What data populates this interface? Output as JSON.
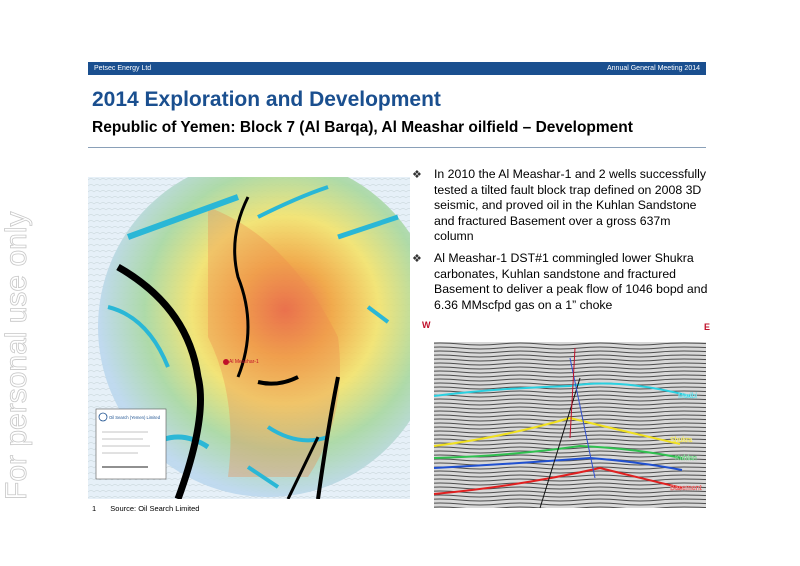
{
  "watermark": "For personal use only",
  "header": {
    "company": "Petsec Energy Ltd",
    "event": "Annual General Meeting 2014"
  },
  "title": "2014 Exploration and Development",
  "subtitle": "Republic of Yemen: Block 7 (Al Barqa), Al Meashar oilfield – Development",
  "bullets": [
    "In 2010 the Al Meashar-1 and 2 wells successfully tested a tilted fault block trap defined on 2008 3D seismic, and proved oil in the Kuhlan Sandstone and fractured Basement over a gross 637m column",
    "Al Meashar-1 DST#1 commingled lower Shukra carbonates, Kuhlan sandstone and fractured Basement to deliver a peak flow of 1046 bopd and 6.36 MMscfpd gas on a 1” choke"
  ],
  "map": {
    "well_label": "Al Meashar-1",
    "company_label": "Oil Search (Yemen) Limited"
  },
  "seismic": {
    "west": "W",
    "east": "E",
    "horizons": [
      "Madbi",
      "Shukra",
      "Kuhlan",
      "Basement"
    ]
  },
  "footnote": {
    "number": "1",
    "text": "Source: Oil Search Limited"
  }
}
